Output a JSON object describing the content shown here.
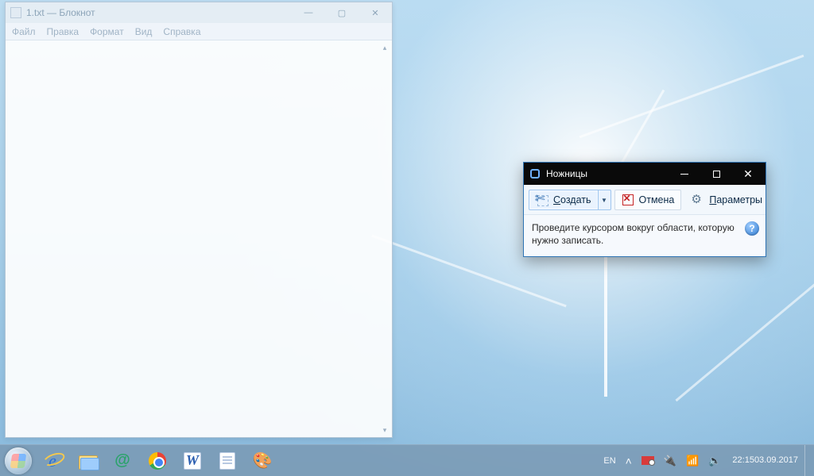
{
  "notepad": {
    "title": "1.txt — Блокнот",
    "menu": {
      "file": "Файл",
      "edit": "Правка",
      "format": "Формат",
      "view": "Вид",
      "help": "Справка"
    }
  },
  "snip": {
    "title": "Ножницы",
    "new_label": "Создать",
    "cancel_label": "Отмена",
    "options_label": "Параметры",
    "hint": "Проведите курсором вокруг области, которую нужно записать.",
    "help_badge": "?"
  },
  "tray": {
    "lang": "EN",
    "time": "22:15",
    "date": "03.09.2017"
  }
}
